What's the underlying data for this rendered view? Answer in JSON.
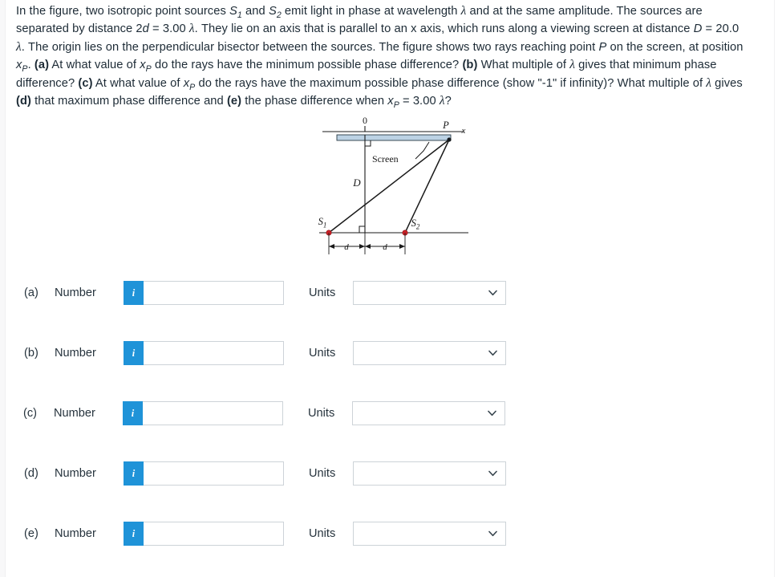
{
  "problem": {
    "sentences": [
      "In the figure, two isotropic point sources S₁ and S₂ emit light in phase at wavelength λ and at the same amplitude.",
      "The sources are separated by distance 2d = 3.00 λ.",
      "They lie on an axis that is parallel to an x axis, which runs along a viewing screen at distance D = 20.0 λ.",
      "The origin lies on the perpendicular bisector between the sources.",
      "The figure shows two rays reaching point P on the screen, at position x_P.",
      "(a) At what value of x_P do the rays have the minimum possible phase difference?",
      "(b) What multiple of λ gives that minimum phase difference?",
      "(c) At what value of x_P do the rays have the maximum possible phase difference (show \"-1\" if infinity)?",
      "What multiple of λ gives (d) that maximum phase difference and (e) the phase difference when x_P = 3.00 λ?"
    ],
    "separation_label": "2d = 3.00 λ",
    "distance_label": "D = 20.0 λ",
    "xp_value": "3.00 λ",
    "infinity_sentinel": "-1"
  },
  "figure": {
    "labels": {
      "origin": "0",
      "point_p": "P",
      "x_axis": "x",
      "screen": "Screen",
      "distance_d_big": "D",
      "source1": "S",
      "source1_sub": "1",
      "source2": "S",
      "source2_sub": "2",
      "half_sep_left": "d",
      "half_sep_right": "d"
    },
    "colors": {
      "screen_fill": "#bcd2e4",
      "source_dot": "#cc2127",
      "line": "#1a1a1a"
    }
  },
  "answers": {
    "units_placeholder": "",
    "number_placeholder": "",
    "info_glyph": "i",
    "chevron_icon": "chevron-down-icon",
    "rows": [
      {
        "id": "a",
        "label": "(a)",
        "number_label": "Number",
        "number_value": "",
        "units_label": "Units",
        "units_value": ""
      },
      {
        "id": "b",
        "label": "(b)",
        "number_label": "Number",
        "number_value": "",
        "units_label": "Units",
        "units_value": ""
      },
      {
        "id": "c",
        "label": "(c)",
        "number_label": "Number",
        "number_value": "",
        "units_label": "Units",
        "units_value": ""
      },
      {
        "id": "d",
        "label": "(d)",
        "number_label": "Number",
        "number_value": "",
        "units_label": "Units",
        "units_value": ""
      },
      {
        "id": "e",
        "label": "(e)",
        "number_label": "Number",
        "number_value": "",
        "units_label": "Units",
        "units_value": ""
      }
    ]
  },
  "theme": {
    "accent_blue": "#1f93d8",
    "text_color": "#1d2b36",
    "field_border": "#cdd3d8",
    "background": "#ffffff"
  }
}
